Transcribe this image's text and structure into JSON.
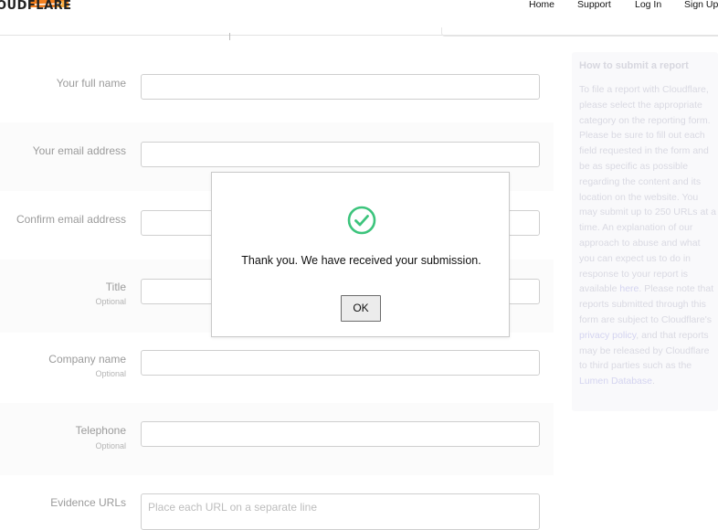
{
  "header": {
    "logo_text": "OUDFLARE",
    "nav": [
      {
        "label": "Home"
      },
      {
        "label": "Support"
      },
      {
        "label": "Log In"
      },
      {
        "label": "Sign Up"
      }
    ]
  },
  "form": {
    "fields": [
      {
        "label": "Your full name",
        "optional": "",
        "placeholder": ""
      },
      {
        "label": "Your email address",
        "optional": "",
        "placeholder": ""
      },
      {
        "label": "Confirm email address",
        "optional": "",
        "placeholder": ""
      },
      {
        "label": "Title",
        "optional": "Optional",
        "placeholder": ""
      },
      {
        "label": "Company name",
        "optional": "Optional",
        "placeholder": ""
      },
      {
        "label": "Telephone",
        "optional": "Optional",
        "placeholder": ""
      },
      {
        "label": "Evidence URLs",
        "optional": "",
        "placeholder": "Place each URL on a separate line"
      }
    ]
  },
  "sidebar": {
    "title": "How to submit a report",
    "text_1": "To file a report with Cloudflare, please select the appropriate category on the reporting form. Please be sure to fill out each field requested in the form and be as specific as possible regarding the content and its location on the website. You may submit up to 250 URLs at a time. An explanation of our approach to abuse and what you can expect us to do in response to your report is available",
    "link_here": "here",
    "text_2": ". Please note that reports submitted through this form are subject to Cloudflare's",
    "link_privacy": "privacy policy",
    "text_3": ", and that reports may be released by Cloudflare to third parties such as the",
    "link_lumen": "Lumen Database",
    "text_4": "."
  },
  "modal": {
    "message": "Thank you. We have received your submission.",
    "ok_label": "OK",
    "icon": "check-circle-icon",
    "icon_color": "#3cc47c"
  },
  "colors": {
    "brand_orange": "#f38020",
    "brand_orange_light": "#fbad41"
  }
}
